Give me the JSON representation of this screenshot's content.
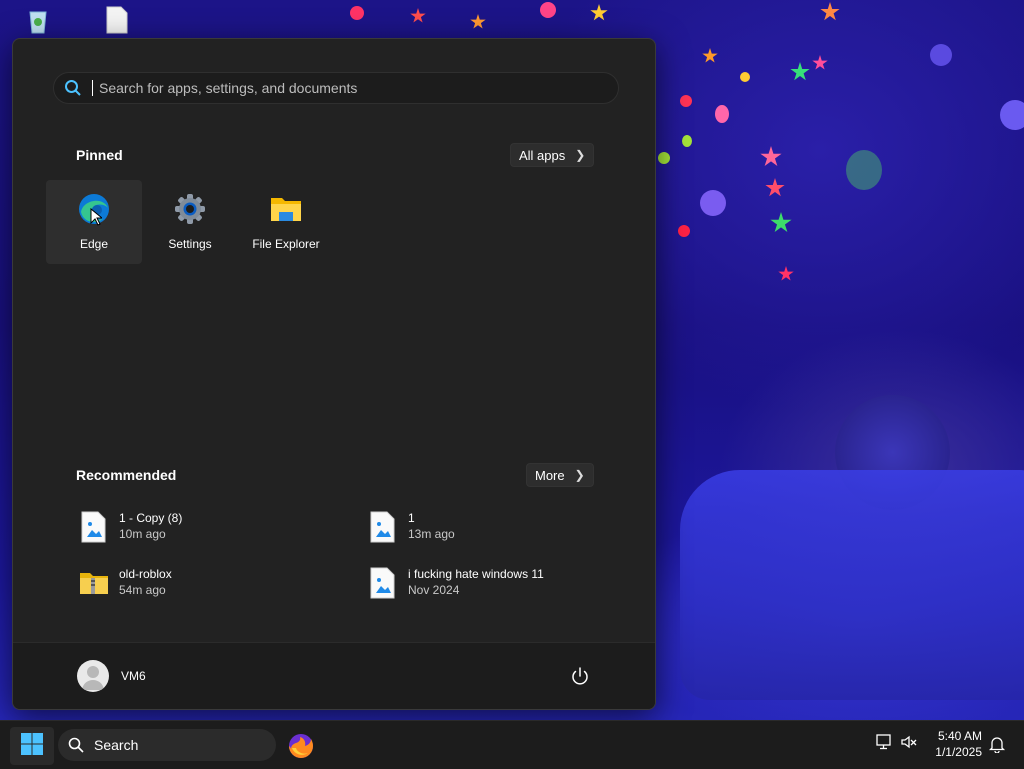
{
  "start_menu": {
    "search": {
      "placeholder": "Search for apps, settings, and documents",
      "value": ""
    },
    "pinned": {
      "title": "Pinned",
      "all_apps_label": "All apps",
      "apps": [
        {
          "label": "Edge",
          "icon": "edge-icon",
          "highlighted": true
        },
        {
          "label": "Settings",
          "icon": "settings-gear-icon"
        },
        {
          "label": "File Explorer",
          "icon": "folder-icon"
        }
      ]
    },
    "recommended": {
      "title": "Recommended",
      "more_label": "More",
      "items": [
        {
          "name": "1 - Copy (8)",
          "time": "10m ago",
          "icon": "image-file-icon"
        },
        {
          "name": "1",
          "time": "13m ago",
          "icon": "image-file-icon"
        },
        {
          "name": "old-roblox",
          "time": "54m ago",
          "icon": "zip-folder-icon"
        },
        {
          "name": "i fucking hate windows 11",
          "time": "Nov 2024",
          "icon": "image-file-icon"
        }
      ]
    },
    "user": {
      "name": "VM6",
      "icon": "avatar-icon"
    },
    "power_icon": "power-icon"
  },
  "taskbar": {
    "search_label": "Search",
    "start_icon": "windows-logo-icon",
    "apps": [
      {
        "icon": "firefox-icon"
      }
    ],
    "clock": {
      "time": "5:40 AM",
      "date": "1/1/2025"
    },
    "tray_icons": [
      "network-icon",
      "volume-muted-icon",
      "notification-bell-icon"
    ]
  },
  "colors": {
    "menu_bg": "#222222",
    "footer_bg": "#1c1c1c",
    "taskbar_bg": "#1c1c1c",
    "accent": "#0078d4"
  }
}
